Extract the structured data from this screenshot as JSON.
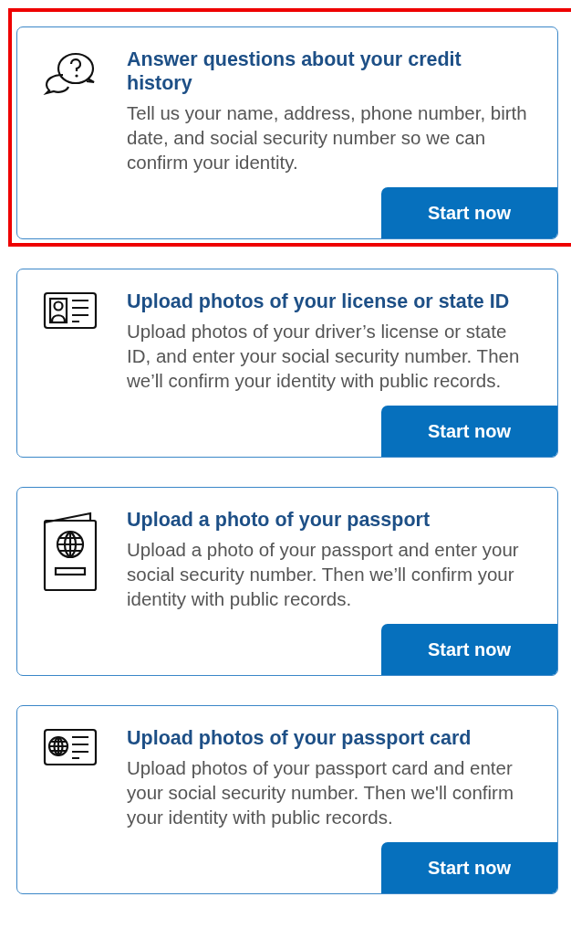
{
  "options": [
    {
      "kind": "chat",
      "selected": true,
      "title": "Answer questions about your credit history",
      "description": "Tell us your name, address, phone number, birth date, and social security number so we can confirm your identity.",
      "button": "Start now"
    },
    {
      "kind": "id",
      "selected": false,
      "title": "Upload photos of your license or state ID",
      "description": "Upload photos of your driver’s license or state ID, and enter your social security number. Then we’ll confirm your identity with public records.",
      "button": "Start now"
    },
    {
      "kind": "passport",
      "selected": false,
      "title": "Upload a photo of your passport",
      "description": "Upload a photo of your passport and enter your social security number. Then we’ll confirm your identity with public records.",
      "button": "Start now"
    },
    {
      "kind": "passcard",
      "selected": false,
      "title": "Upload photos of your passport card",
      "description": "Upload photos of your passport card and enter your social security number. Then we'll confirm your identity with public records.",
      "button": "Start now"
    }
  ]
}
